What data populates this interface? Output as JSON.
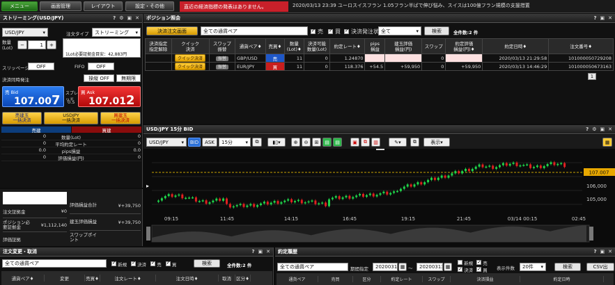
{
  "topbar": {
    "menu": "メニュー",
    "screen_mgmt": "画面管理",
    "layout": "レイアウト",
    "settings": "設定・その他",
    "alert": "直近の経済指標の発表はありません。",
    "ticker": "2020/03/13 23:39  ユーロスイスフラン  1.05フラン半ばで伸び悩み、スイスは100億フラン規模の支援措置"
  },
  "streaming": {
    "title": "ストリーミング(USD/JPY)",
    "pair": "USD/JPY",
    "order_type_label": "注文タイプ",
    "order_type": "ストリーミング",
    "qty_label": "数量\n(Lot)",
    "qty": "1",
    "minus": "−",
    "plus": "+",
    "margin_note": "1Lot必要証拠金目安：42,883円",
    "slippage_label": "スリッページ",
    "slippage": "OFF",
    "fifo_label": "FIFO",
    "fifo": "OFF",
    "settle_label": "決済同時発注",
    "touch": "操縦 OFF",
    "unlimited": "無期限",
    "bid_label": "売 Bid",
    "bid_main": "107.00",
    "bid_big": "7",
    "ask_label": "買 Ask",
    "ask_main": "107.01",
    "ask_big": "2",
    "spread_label": "スプレッド",
    "spread": "0.5",
    "bulk_sell": "売建玉\n一括決済",
    "bulk_all": "USDJPY\n一括決済",
    "bulk_buy": "買建玉\n一括決済",
    "pos_hdr_sell": "売建",
    "pos_hdr_buy": "買建",
    "rows": [
      {
        "l": "0",
        "m": "数量(Lot)",
        "r": "0"
      },
      {
        "l": "0",
        "m": "平均約定レート",
        "r": "0"
      },
      {
        "l": "0.0",
        "m": "pips損益",
        "r": "0.0"
      },
      {
        "l": "0",
        "m": "評価損益(円)",
        "r": "0"
      }
    ]
  },
  "account": {
    "rows": [
      {
        "k": "注文証拠金",
        "v": "¥0",
        "k2": "評価損益合計",
        "v2": "¥+39,750"
      },
      {
        "k": "ポジション必要証拠金",
        "v": "¥1,112,140",
        "k2": "建玉評価損益",
        "v2": "¥+39,750"
      },
      {
        "k": "評価証拠",
        "v": "",
        "k2": "スワップポイント",
        "v2": ""
      }
    ]
  },
  "positions": {
    "title": "ポジション照会",
    "settle_screen": "決済注文画面",
    "pair_select": "全ての通貨ペア",
    "sell": "売",
    "buy": "買",
    "settle_status_label": "決済発注状況",
    "settle_status": "全て",
    "search": "検索",
    "count": "全件数:2 件",
    "headers": [
      "決済指定\n指定解除",
      "クイック\n決済",
      "スワップ\n振替",
      "通貨ペア♦",
      "売買♦",
      "数量\n(Lot)♦",
      "決済可能\n数量(Lot)",
      "約定レート♦",
      "pips\n損益",
      "建玉評価\n損益(円)",
      "スワップ",
      "約定評価\n損益(円)♦",
      "約定日時♦",
      "注文番号♦"
    ],
    "quick": "クイック決済",
    "transfer": "振替",
    "rows": [
      {
        "pair": "GBP/USD",
        "side": "売",
        "lot": "11",
        "avail": "0",
        "rate": "1.24870",
        "pips": "",
        "pl": "",
        "swap": "0",
        "total": "",
        "time": "2020/03/13 21:29:58",
        "no": "101000050729208"
      },
      {
        "pair": "EUR/JPY",
        "side": "買",
        "lot": "11",
        "avail": "0",
        "rate": "118.376",
        "pips": "+54.5",
        "pl": "+59,950",
        "swap": "0",
        "total": "+59,950",
        "time": "2020/03/13 14:46:29",
        "no": "101000050673163"
      }
    ],
    "page": "1"
  },
  "chart": {
    "title": "USD/JPY 15分 BID",
    "pair": "USD/JPY",
    "bid": "BID",
    "ask": "ASK",
    "interval": "15分",
    "display": "表示",
    "price_tag": "107.007",
    "yticks": [
      "106,000",
      "105,000"
    ],
    "xticks": [
      "09:15",
      "11:45",
      "14:15",
      "16:45",
      "19:15",
      "21:45",
      "03/14 00:15",
      "02:45"
    ]
  },
  "orders": {
    "title": "注文変更・取消",
    "pair_select": "全ての通貨ペア",
    "new": "新規",
    "settle": "決済",
    "sell": "売",
    "buy": "買",
    "search": "検索",
    "count": "全件数:2 件",
    "headers": [
      "通貨ペア♦",
      "変更",
      "売買♦",
      "注文レート♦",
      "注文日時♦",
      "取消",
      "区分♦"
    ]
  },
  "executions": {
    "title": "約定履歴",
    "pair_select": "全ての通貨ペア",
    "period_label": "期間指定",
    "from": "20200313",
    "to": "20200313",
    "new": "新規",
    "sell": "売",
    "settle": "決済",
    "buy": "買",
    "show_count_label": "表示件数",
    "show_count": "20件",
    "search": "検索",
    "csv": "CSV出",
    "headers": [
      "通貨ペア",
      "売買",
      "区分",
      "約定レート",
      "スワップ",
      "決済損益",
      "約定日時"
    ]
  }
}
